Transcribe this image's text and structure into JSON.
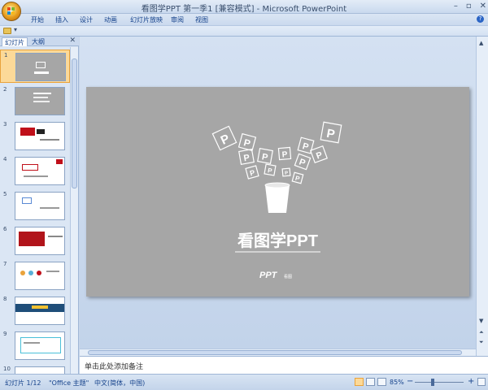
{
  "window": {
    "title": "看图学PPT 第一季1 [兼容模式] - Microsoft PowerPoint",
    "minimize_glyph": "–",
    "restore_glyph": "▫",
    "close_glyph": "✕"
  },
  "ribbon": {
    "tabs": [
      "开始",
      "插入",
      "设计",
      "动画",
      "幻灯片放映",
      "审阅",
      "视图"
    ],
    "help_glyph": "?",
    "qat_dropdown": "▾"
  },
  "left_pane": {
    "tabs": [
      "幻灯片",
      "大纲"
    ],
    "close_glyph": "✕",
    "selected_index": 0,
    "thumbnails": [
      {
        "number": "1",
        "kind": "cover"
      },
      {
        "number": "2",
        "kind": "text"
      },
      {
        "number": "3",
        "kind": "red"
      },
      {
        "number": "4",
        "kind": "redsmall"
      },
      {
        "number": "5",
        "kind": "white"
      },
      {
        "number": "6",
        "kind": "darkred"
      },
      {
        "number": "7",
        "kind": "icons"
      },
      {
        "number": "8",
        "kind": "bluestrip"
      },
      {
        "number": "9",
        "kind": "cyanbox"
      },
      {
        "number": "10",
        "kind": "plain"
      }
    ]
  },
  "slide": {
    "title": "看图学PPT",
    "p_letter": "P",
    "logo_main": "PPT",
    "logo_sub": "看图",
    "background_color": "#a6a6a6"
  },
  "notes": {
    "placeholder": "单击此处添加备注"
  },
  "status_bar": {
    "slide_counter": "幻灯片 1/12",
    "theme": "\"Office 主题\"",
    "language": "中文(简体，中国)",
    "zoom": "85%",
    "zoom_out": "−",
    "zoom_in": "+"
  },
  "colors": {
    "ribbon_text": "#15428b",
    "selection": "#fcd998",
    "office_orange": "#e59a1a"
  }
}
